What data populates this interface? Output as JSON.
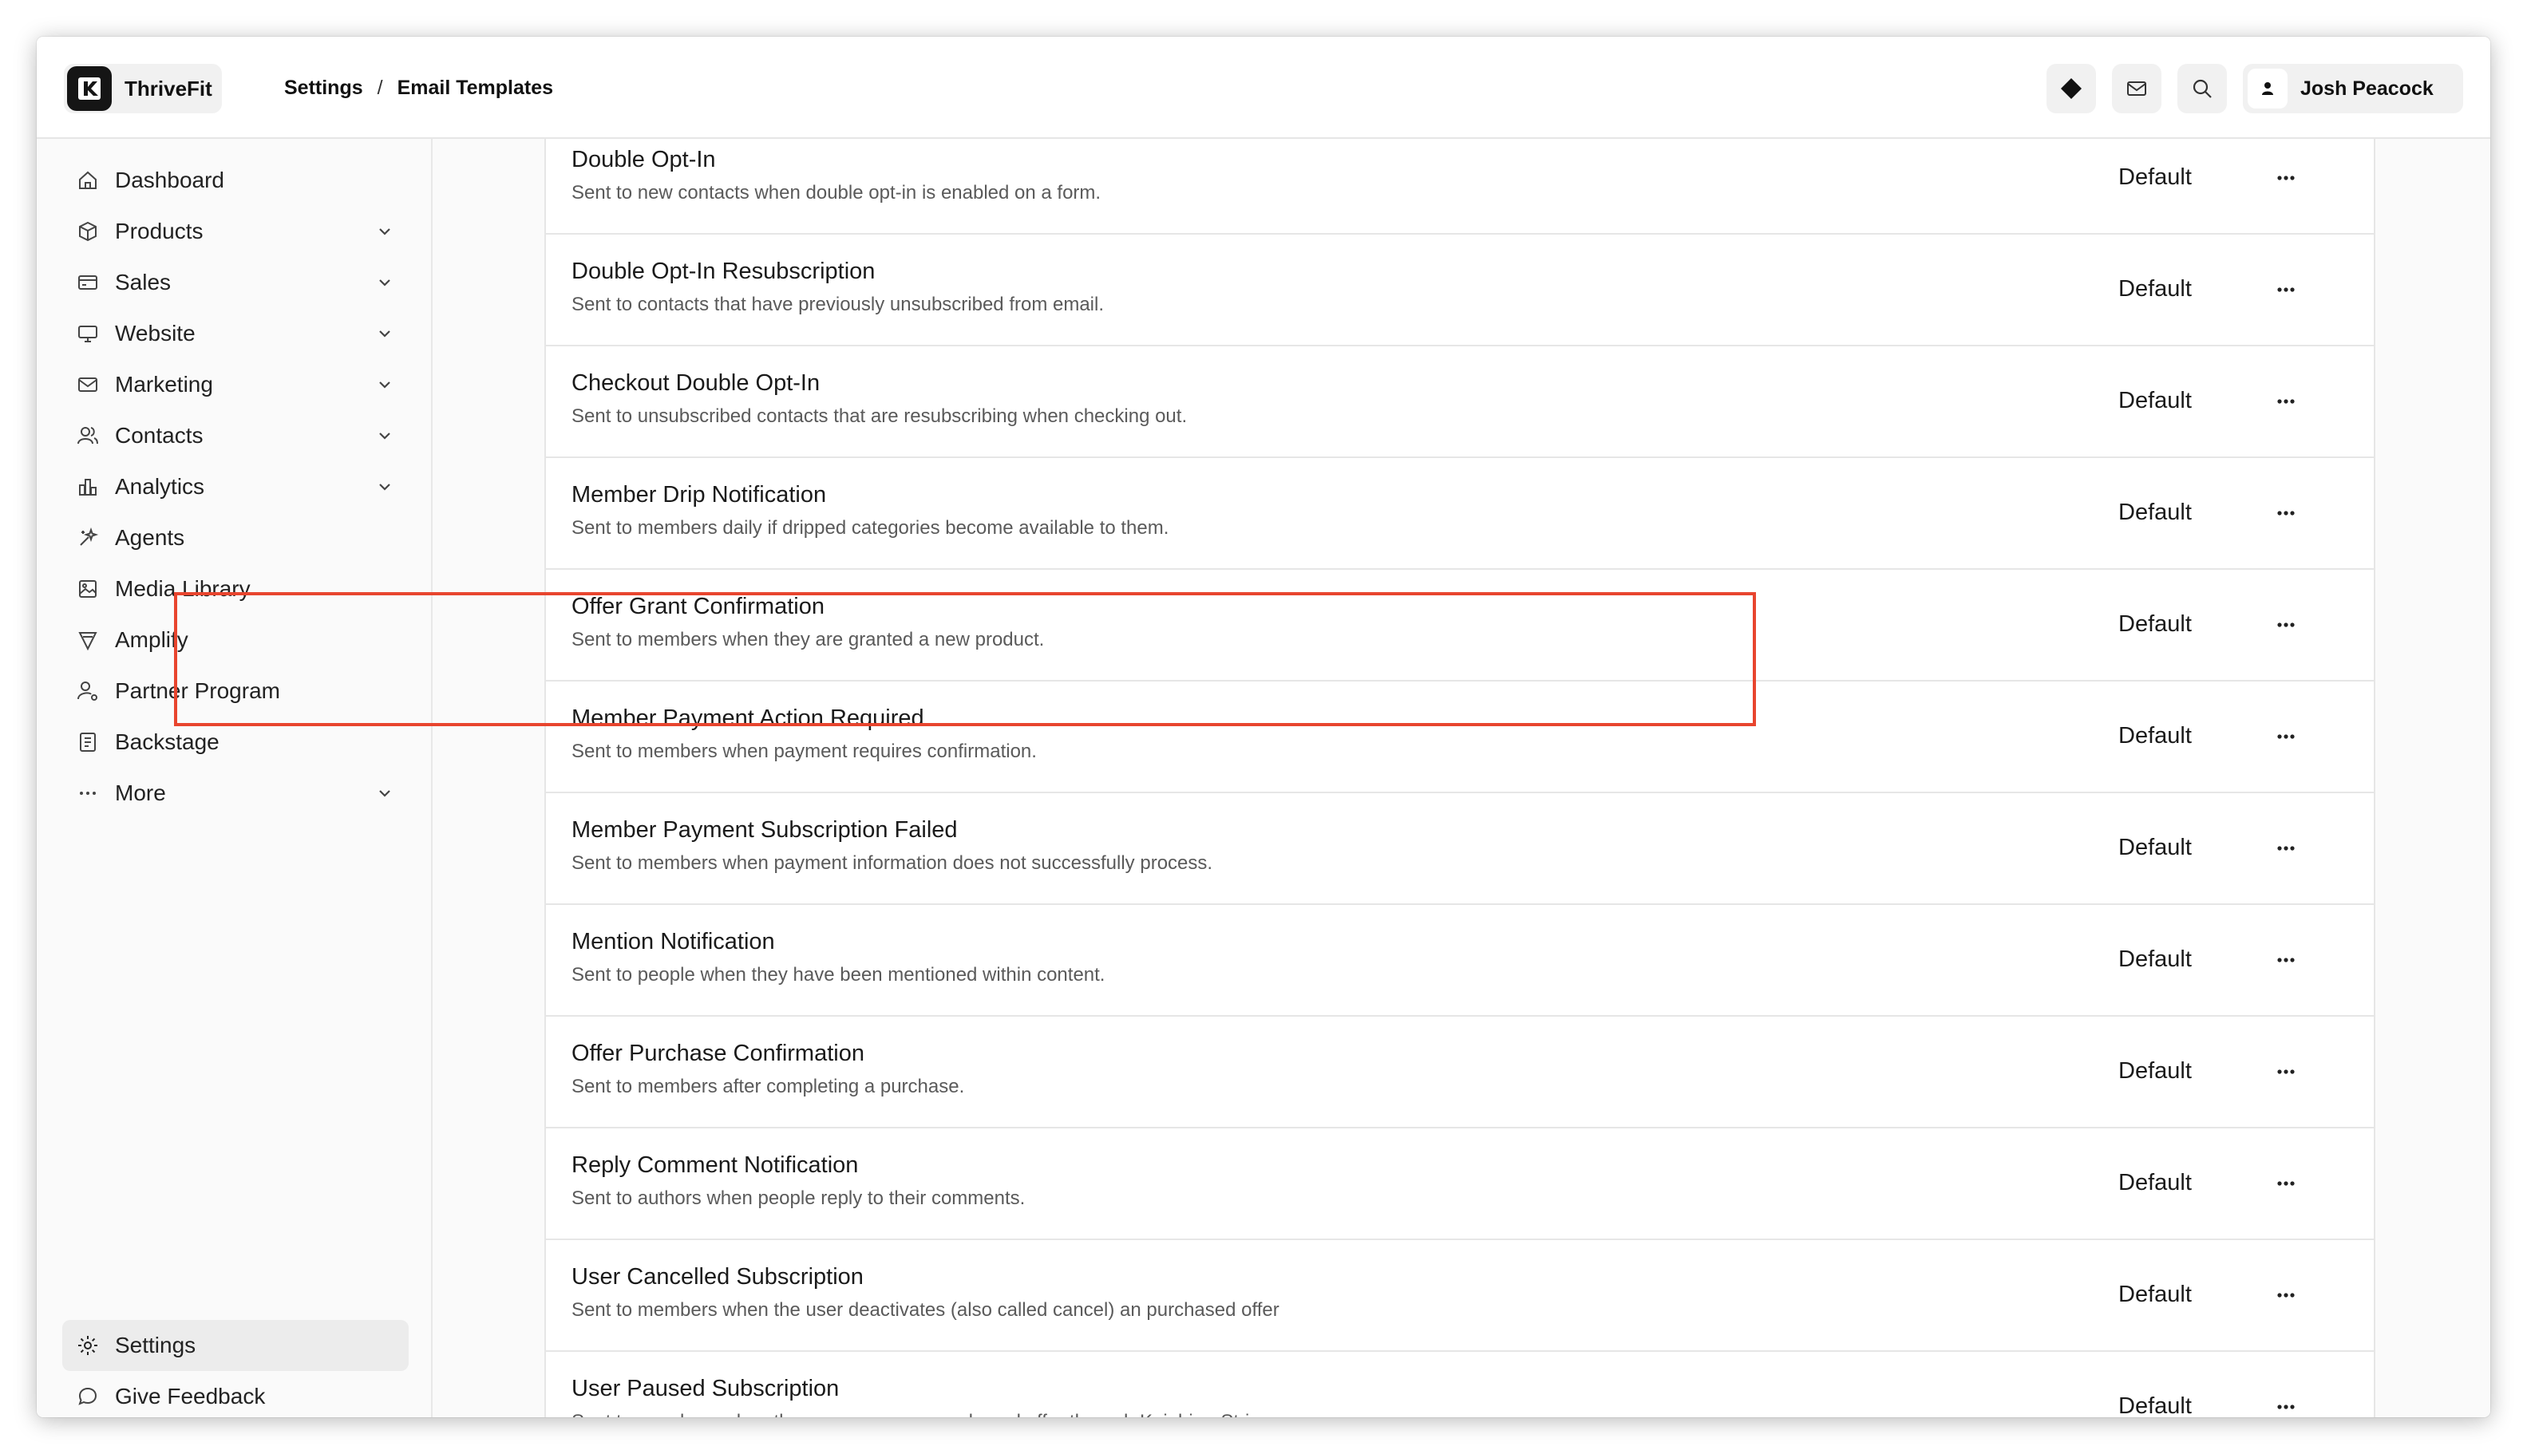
{
  "app": {
    "name": "ThriveFit"
  },
  "breadcrumb": {
    "parent": "Settings",
    "separator": "/",
    "current": "Email Templates"
  },
  "topbar": {
    "icons": [
      "diamond-icon",
      "mail-icon",
      "search-icon"
    ],
    "user": {
      "name": "Josh Peacock"
    }
  },
  "sidebar": {
    "items": [
      {
        "label": "Dashboard",
        "icon": "home-icon",
        "expandable": false
      },
      {
        "label": "Products",
        "icon": "box-icon",
        "expandable": true
      },
      {
        "label": "Sales",
        "icon": "credit-card-icon",
        "expandable": true
      },
      {
        "label": "Website",
        "icon": "monitor-icon",
        "expandable": true
      },
      {
        "label": "Marketing",
        "icon": "mail-icon",
        "expandable": true
      },
      {
        "label": "Contacts",
        "icon": "users-icon",
        "expandable": true
      },
      {
        "label": "Analytics",
        "icon": "bar-chart-icon",
        "expandable": true
      },
      {
        "label": "Agents",
        "icon": "sparkle-icon",
        "expandable": false
      },
      {
        "label": "Media Library",
        "icon": "image-icon",
        "expandable": false
      },
      {
        "label": "Amplify",
        "icon": "megaphone-icon",
        "expandable": false
      },
      {
        "label": "Partner Program",
        "icon": "user-gear-icon",
        "expandable": false
      },
      {
        "label": "Backstage",
        "icon": "document-icon",
        "expandable": false
      },
      {
        "label": "More",
        "icon": "ellipsis-icon",
        "expandable": true
      }
    ],
    "bottom": [
      {
        "label": "Settings",
        "icon": "gear-icon",
        "active": true
      },
      {
        "label": "Give Feedback",
        "icon": "chat-bubble-icon",
        "active": false
      }
    ]
  },
  "templates": [
    {
      "title": "Double Opt-In",
      "description": "Sent to new contacts when double opt-in is enabled on a form.",
      "status": "Default"
    },
    {
      "title": "Double Opt-In Resubscription",
      "description": "Sent to contacts that have previously unsubscribed from email.",
      "status": "Default"
    },
    {
      "title": "Checkout Double Opt-In",
      "description": "Sent to unsubscribed contacts that are resubscribing when checking out.",
      "status": "Default"
    },
    {
      "title": "Member Drip Notification",
      "description": "Sent to members daily if dripped categories become available to them.",
      "status": "Default"
    },
    {
      "title": "Offer Grant Confirmation",
      "description": "Sent to members when they are granted a new product.",
      "status": "Default"
    },
    {
      "title": "Member Payment Action Required",
      "description": "Sent to members when payment requires confirmation.",
      "status": "Default",
      "highlighted": true
    },
    {
      "title": "Member Payment Subscription Failed",
      "description": "Sent to members when payment information does not successfully process.",
      "status": "Default"
    },
    {
      "title": "Mention Notification",
      "description": "Sent to people when they have been mentioned within content.",
      "status": "Default"
    },
    {
      "title": "Offer Purchase Confirmation",
      "description": "Sent to members after completing a purchase.",
      "status": "Default"
    },
    {
      "title": "Reply Comment Notification",
      "description": "Sent to authors when people reply to their comments.",
      "status": "Default"
    },
    {
      "title": "User Cancelled Subscription",
      "description": "Sent to members when the user deactivates (also called cancel) an purchased offer",
      "status": "Default"
    },
    {
      "title": "User Paused Subscription",
      "description": "Sent to members when the user pauses a purchased offer through Kajabi or Stripe",
      "status": "Default"
    }
  ],
  "colors": {
    "highlight": "#e8452e",
    "active_nav": "#ececec"
  }
}
